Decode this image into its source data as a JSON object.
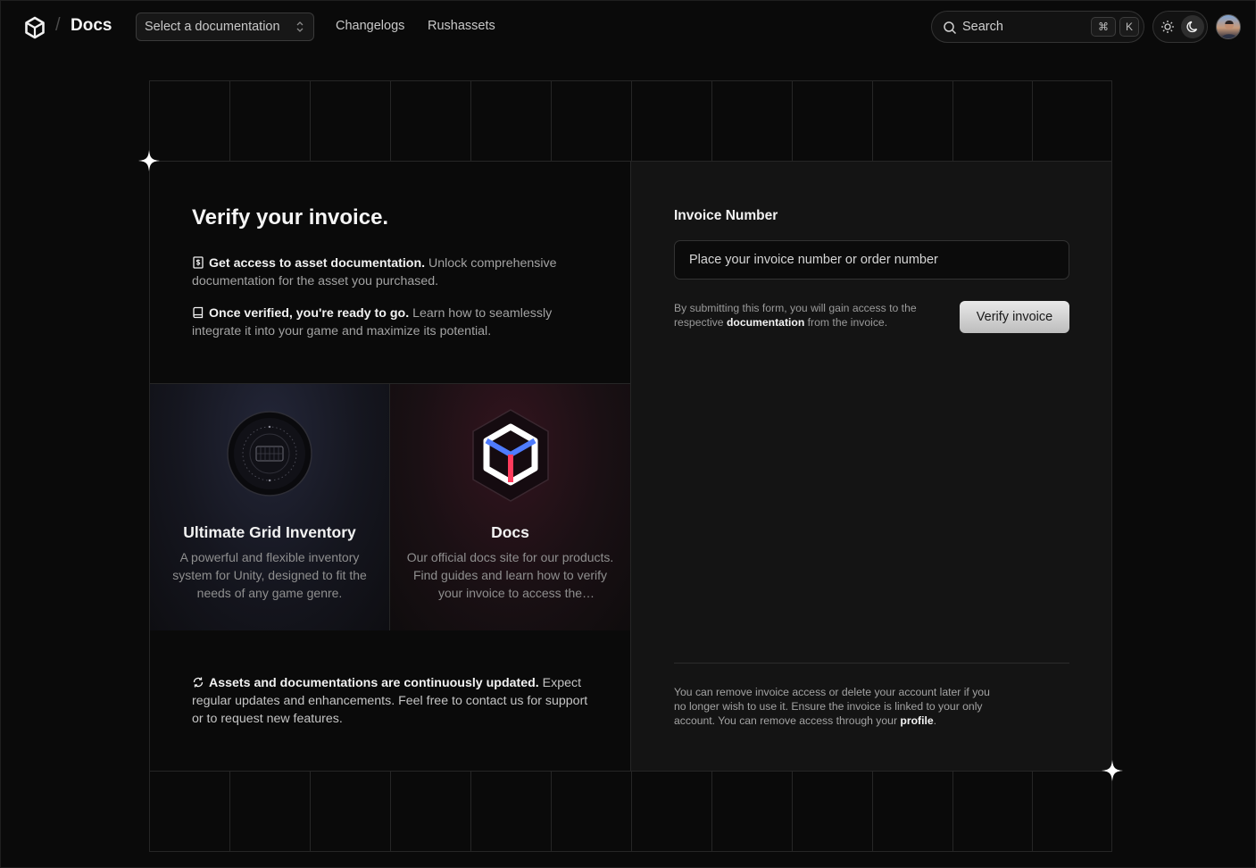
{
  "topbar": {
    "brand": "Docs",
    "separator": "/",
    "select_label": "Select a documentation",
    "links": [
      "Changelogs",
      "Rushassets"
    ],
    "search_label": "Search",
    "shortcut_keys": [
      "⌘",
      "K"
    ]
  },
  "intro": {
    "title": "Verify your invoice.",
    "features": [
      {
        "icon": "receipt-icon",
        "bold": "Get access to asset documentation.",
        "text": " Unlock comprehensive documentation for the asset you purchased."
      },
      {
        "icon": "book-icon",
        "bold": "Once verified, you're ready to go.",
        "text": " Learn how to seamlessly integrate it into your game and maximize its potential."
      }
    ],
    "update_note": {
      "icon": "refresh-icon",
      "bold": "Assets and documentations are continuously updated.",
      "text": " Expect regular updates and enhancements. Feel free to contact us for support or to request new features."
    }
  },
  "cards": [
    {
      "title": "Ultimate Grid Inventory",
      "description": "A powerful and flexible inventory system for Unity, designed to fit the needs of any game genre.",
      "logo": "inventory-badge-icon"
    },
    {
      "title": "Docs",
      "description": "Our official docs site for our products. Find guides and learn how to verify your invoice to access the documentation.",
      "logo": "cube-logo-icon"
    }
  ],
  "form": {
    "label": "Invoice Number",
    "placeholder": "Place your invoice number or order number",
    "value": "",
    "note_before": "By submitting this form, you will gain access to the respective ",
    "note_link": "documentation",
    "note_after": " from the invoice.",
    "submit": "Verify invoice",
    "footer_before": "You can remove invoice access or delete your account later if you no longer wish to use it. Ensure the invoice is linked to your only account. You can remove access through your ",
    "footer_link": "profile",
    "footer_after": "."
  },
  "colors": {
    "accent_blue": "#4f7cff",
    "accent_red": "#ff3b5c",
    "background": "#0a0a0a",
    "panel": "#141414"
  }
}
